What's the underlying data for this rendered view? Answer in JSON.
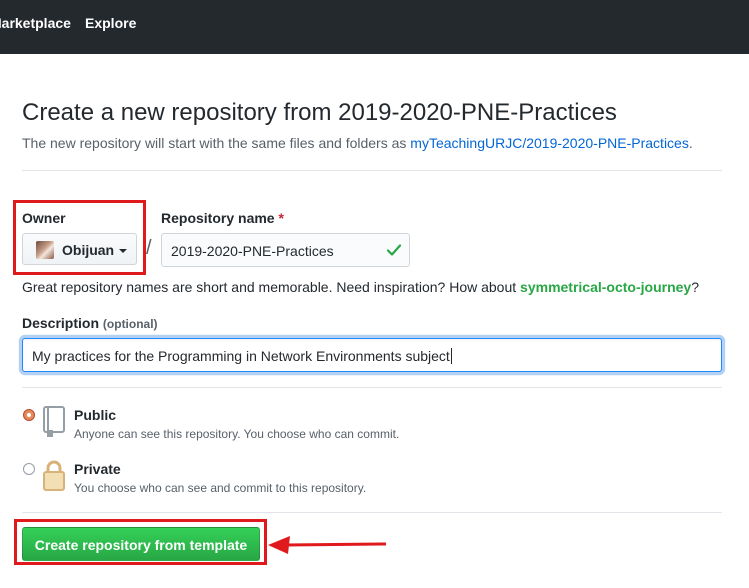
{
  "header": {
    "nav": [
      "Marketplace",
      "Explore"
    ]
  },
  "page": {
    "title": "Create a new repository from 2019-2020-PNE-Practices",
    "subtitle_prefix": "The new repository will start with the same files and folders as ",
    "subtitle_link": "myTeachingURJC/2019-2020-PNE-Practices",
    "subtitle_suffix": "."
  },
  "owner": {
    "label": "Owner",
    "value": "Obijuan"
  },
  "repo": {
    "label": "Repository name",
    "required_mark": "*",
    "separator": "/",
    "value": "2019-2020-PNE-Practices"
  },
  "hint": {
    "prefix": "Great repository names are short and memorable. Need inspiration? How about ",
    "suggestion": "symmetrical-octo-journey",
    "suffix": "?"
  },
  "description": {
    "label": "Description",
    "optional": "(optional)",
    "value": "My practices for the Programming in Network Environments subject"
  },
  "visibility": {
    "public_title": "Public",
    "public_desc": "Anyone can see this repository. You choose who can commit.",
    "private_title": "Private",
    "private_desc": "You choose who can see and commit to this repository.",
    "selected": "public"
  },
  "submit": {
    "label": "Create repository from template"
  },
  "colors": {
    "header_bg": "#24292e",
    "link": "#0366d6",
    "suggestion": "#28a745",
    "button": "#28a745",
    "annotation": "#e0191d"
  },
  "icons": {
    "repo_public": "repo-icon",
    "repo_private": "lock-icon",
    "valid": "check-icon",
    "dropdown": "caret-down-icon"
  }
}
